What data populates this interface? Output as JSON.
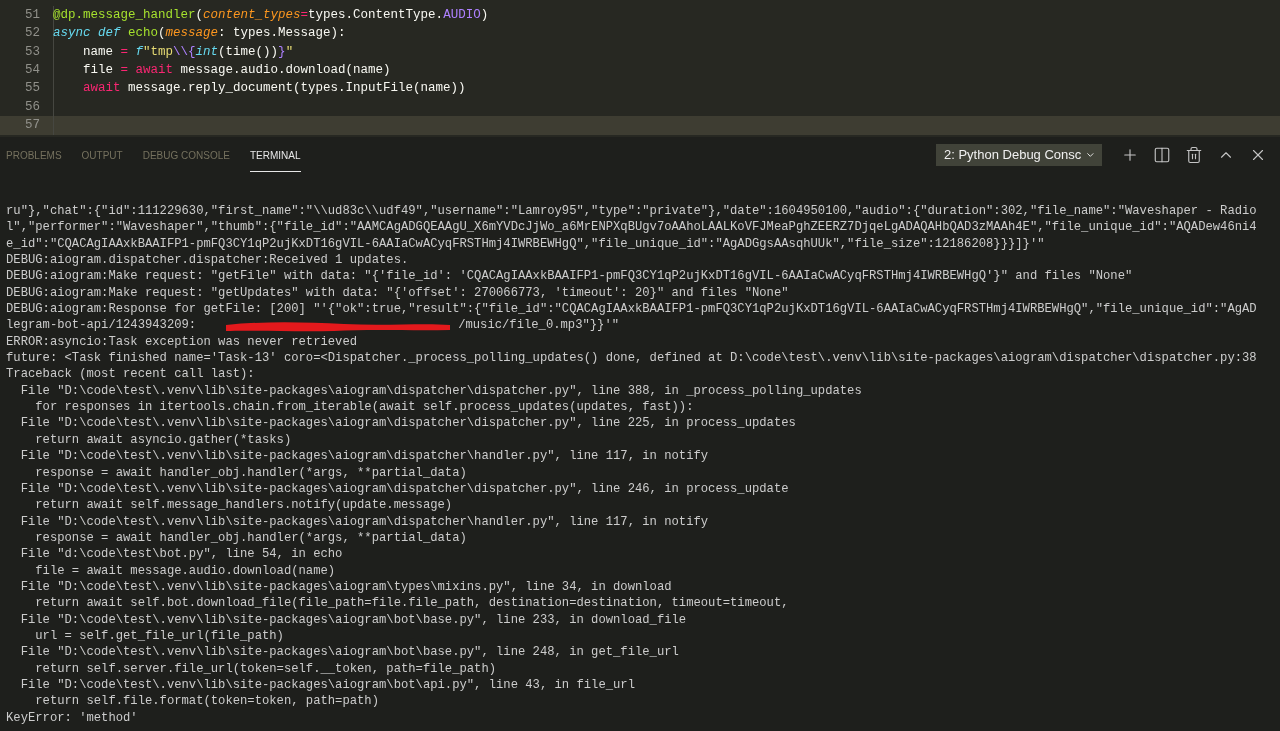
{
  "editor": {
    "lines": [
      {
        "number": "51",
        "current": false,
        "tokens": [
          {
            "kind": "func",
            "text": "@dp.message_handler"
          },
          {
            "kind": "plain",
            "text": "("
          },
          {
            "kind": "param",
            "text": "content_types"
          },
          {
            "kind": "operator",
            "text": "="
          },
          {
            "kind": "plain",
            "text": "types.ContentType."
          },
          {
            "kind": "constant",
            "text": "AUDIO"
          },
          {
            "kind": "plain",
            "text": ")"
          }
        ]
      },
      {
        "number": "52",
        "current": false,
        "tokens": [
          {
            "kind": "keyword",
            "text": "async def"
          },
          {
            "kind": "func",
            "text": " echo"
          },
          {
            "kind": "plain",
            "text": "("
          },
          {
            "kind": "param",
            "text": "message"
          },
          {
            "kind": "plain",
            "text": ": types.Message):"
          }
        ]
      },
      {
        "number": "53",
        "current": false,
        "tokens": [
          {
            "kind": "plain",
            "text": "    name "
          },
          {
            "kind": "operator",
            "text": "="
          },
          {
            "kind": "keyword",
            "text": " f"
          },
          {
            "kind": "string",
            "text": "\"tmp"
          },
          {
            "kind": "constant",
            "text": "\\\\{"
          },
          {
            "kind": "keyword",
            "text": "int"
          },
          {
            "kind": "plain",
            "text": "(time())"
          },
          {
            "kind": "constant",
            "text": "}"
          },
          {
            "kind": "string",
            "text": "\""
          }
        ]
      },
      {
        "number": "54",
        "current": false,
        "tokens": [
          {
            "kind": "plain",
            "text": "    file "
          },
          {
            "kind": "operator",
            "text": "= await"
          },
          {
            "kind": "plain",
            "text": " message.audio.download(name)"
          }
        ]
      },
      {
        "number": "55",
        "current": false,
        "tokens": [
          {
            "kind": "operator",
            "text": "    await"
          },
          {
            "kind": "plain",
            "text": " message.reply_document(types.InputFile(name))"
          }
        ]
      },
      {
        "number": "56",
        "current": false
      },
      {
        "number": "57",
        "current": true
      }
    ]
  },
  "panel": {
    "tabs": [
      {
        "label": "PROBLEMS",
        "selected": false
      },
      {
        "label": "OUTPUT",
        "selected": false
      },
      {
        "label": "DEBUG CONSOLE",
        "selected": false
      },
      {
        "label": "TERMINAL",
        "selected": true
      }
    ],
    "terminal_select": {
      "value": "2: Python Debug Consc"
    }
  },
  "terminal": {
    "lines": [
      {
        "kind": "text",
        "text": "ru\"},\"chat\":{\"id\":111229630,\"first_name\":\"\\\\ud83c\\\\udf49\",\"username\":\"Lamroy95\",\"type\":\"private\"},\"date\":1604950100,\"audio\":{\"duration\":302,\"file_name\":\"Waveshaper - Radio"
      },
      {
        "kind": "text",
        "text": "l\",\"performer\":\"Waveshaper\",\"thumb\":{\"file_id\":\"AAMCAgADGQEAAgU_X6mYVDcJjWo_a6MrENPXqBUgv7oAAhoLAALKoVFJMeaPghZEERZ7DjqeLgADAQAHbQAD3zMAAh4E\",\"file_unique_id\":\"AQADew46ni4"
      },
      {
        "kind": "text",
        "text": "e_id\":\"CQACAgIAAxkBAAIFP1-pmFQ3CY1qP2ujKxDT16gVIL-6AAIaCwACyqFRSTHmj4IWRBEWHgQ\",\"file_unique_id\":\"AgADGgsAAsqhUUk\",\"file_size\":12186208}}}]}'\""
      },
      {
        "kind": "text",
        "text": "DEBUG:aiogram.dispatcher.dispatcher:Received 1 updates."
      },
      {
        "kind": "text",
        "text": "DEBUG:aiogram:Make request: \"getFile\" with data: \"{'file_id': 'CQACAgIAAxkBAAIFP1-pmFQ3CY1qP2ujKxDT16gVIL-6AAIaCwACyqFRSTHmj4IWRBEWHgQ'}\" and files \"None\""
      },
      {
        "kind": "text",
        "text": "DEBUG:aiogram:Make request: \"getUpdates\" with data: \"{'offset': 270066773, 'timeout': 20}\" and files \"None\""
      },
      {
        "kind": "text",
        "text": "DEBUG:aiogram:Response for getFile: [200] \"'{\"ok\":true,\"result\":{\"file_id\":\"CQACAgIAAxkBAAIFP1-pmFQ3CY1qP2ujKxDT16gVIL-6AAIaCwACyqFRSTHmj4IWRBEWHgQ\",\"file_unique_id\":\"AgAD"
      },
      {
        "kind": "redacted",
        "before": "legram-bot-api/1243943209:",
        "after": "/music/file_0.mp3\"}}'\""
      },
      {
        "kind": "text",
        "text": "ERROR:asyncio:Task exception was never retrieved"
      },
      {
        "kind": "text",
        "text": "future: <Task finished name='Task-13' coro=<Dispatcher._process_polling_updates() done, defined at D:\\code\\test\\.venv\\lib\\site-packages\\aiogram\\dispatcher\\dispatcher.py:38"
      },
      {
        "kind": "text",
        "text": "Traceback (most recent call last):"
      },
      {
        "kind": "text",
        "text": "  File \"D:\\code\\test\\.venv\\lib\\site-packages\\aiogram\\dispatcher\\dispatcher.py\", line 388, in _process_polling_updates"
      },
      {
        "kind": "text",
        "text": "    for responses in itertools.chain.from_iterable(await self.process_updates(updates, fast)):"
      },
      {
        "kind": "text",
        "text": "  File \"D:\\code\\test\\.venv\\lib\\site-packages\\aiogram\\dispatcher\\dispatcher.py\", line 225, in process_updates"
      },
      {
        "kind": "text",
        "text": "    return await asyncio.gather(*tasks)"
      },
      {
        "kind": "text",
        "text": "  File \"D:\\code\\test\\.venv\\lib\\site-packages\\aiogram\\dispatcher\\handler.py\", line 117, in notify"
      },
      {
        "kind": "text",
        "text": "    response = await handler_obj.handler(*args, **partial_data)"
      },
      {
        "kind": "text",
        "text": "  File \"D:\\code\\test\\.venv\\lib\\site-packages\\aiogram\\dispatcher\\dispatcher.py\", line 246, in process_update"
      },
      {
        "kind": "text",
        "text": "    return await self.message_handlers.notify(update.message)"
      },
      {
        "kind": "text",
        "text": "  File \"D:\\code\\test\\.venv\\lib\\site-packages\\aiogram\\dispatcher\\handler.py\", line 117, in notify"
      },
      {
        "kind": "text",
        "text": "    response = await handler_obj.handler(*args, **partial_data)"
      },
      {
        "kind": "text",
        "text": "  File \"d:\\code\\test\\bot.py\", line 54, in echo"
      },
      {
        "kind": "text",
        "text": "    file = await message.audio.download(name)"
      },
      {
        "kind": "text",
        "text": "  File \"D:\\code\\test\\.venv\\lib\\site-packages\\aiogram\\types\\mixins.py\", line 34, in download"
      },
      {
        "kind": "text",
        "text": "    return await self.bot.download_file(file_path=file.file_path, destination=destination, timeout=timeout,"
      },
      {
        "kind": "text",
        "text": "  File \"D:\\code\\test\\.venv\\lib\\site-packages\\aiogram\\bot\\base.py\", line 233, in download_file"
      },
      {
        "kind": "text",
        "text": "    url = self.get_file_url(file_path)"
      },
      {
        "kind": "text",
        "text": "  File \"D:\\code\\test\\.venv\\lib\\site-packages\\aiogram\\bot\\base.py\", line 248, in get_file_url"
      },
      {
        "kind": "text",
        "text": "    return self.server.file_url(token=self.__token, path=file_path)"
      },
      {
        "kind": "text",
        "text": "  File \"D:\\code\\test\\.venv\\lib\\site-packages\\aiogram\\bot\\api.py\", line 43, in file_url"
      },
      {
        "kind": "text",
        "text": "    return self.file.format(token=token, path=path)"
      },
      {
        "kind": "text",
        "text": "KeyError: 'method'"
      }
    ]
  }
}
